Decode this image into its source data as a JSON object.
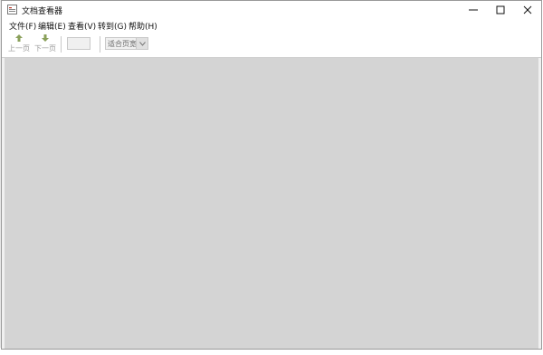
{
  "window": {
    "title": "文档查看器"
  },
  "menu": {
    "items": [
      {
        "label": "文件(F)"
      },
      {
        "label": "编辑(E)"
      },
      {
        "label": "查看(V)"
      },
      {
        "label": "转到(G)"
      },
      {
        "label": "帮助(H)"
      }
    ]
  },
  "toolbar": {
    "prev_label": "上一页",
    "next_label": "下一页",
    "page_value": "",
    "zoom_value": "适合页宽"
  },
  "icons": {
    "prev": "arrow-up-icon",
    "next": "arrow-down-icon",
    "app": "document-viewer-icon",
    "minimize": "minimize-icon",
    "maximize": "maximize-icon",
    "close": "close-icon",
    "dropdown": "chevron-down-icon"
  },
  "colors": {
    "nav_arrow": "#8aa05a",
    "viewer_bg": "#d4d4d4",
    "disabled_text": "#9a9a9a"
  }
}
